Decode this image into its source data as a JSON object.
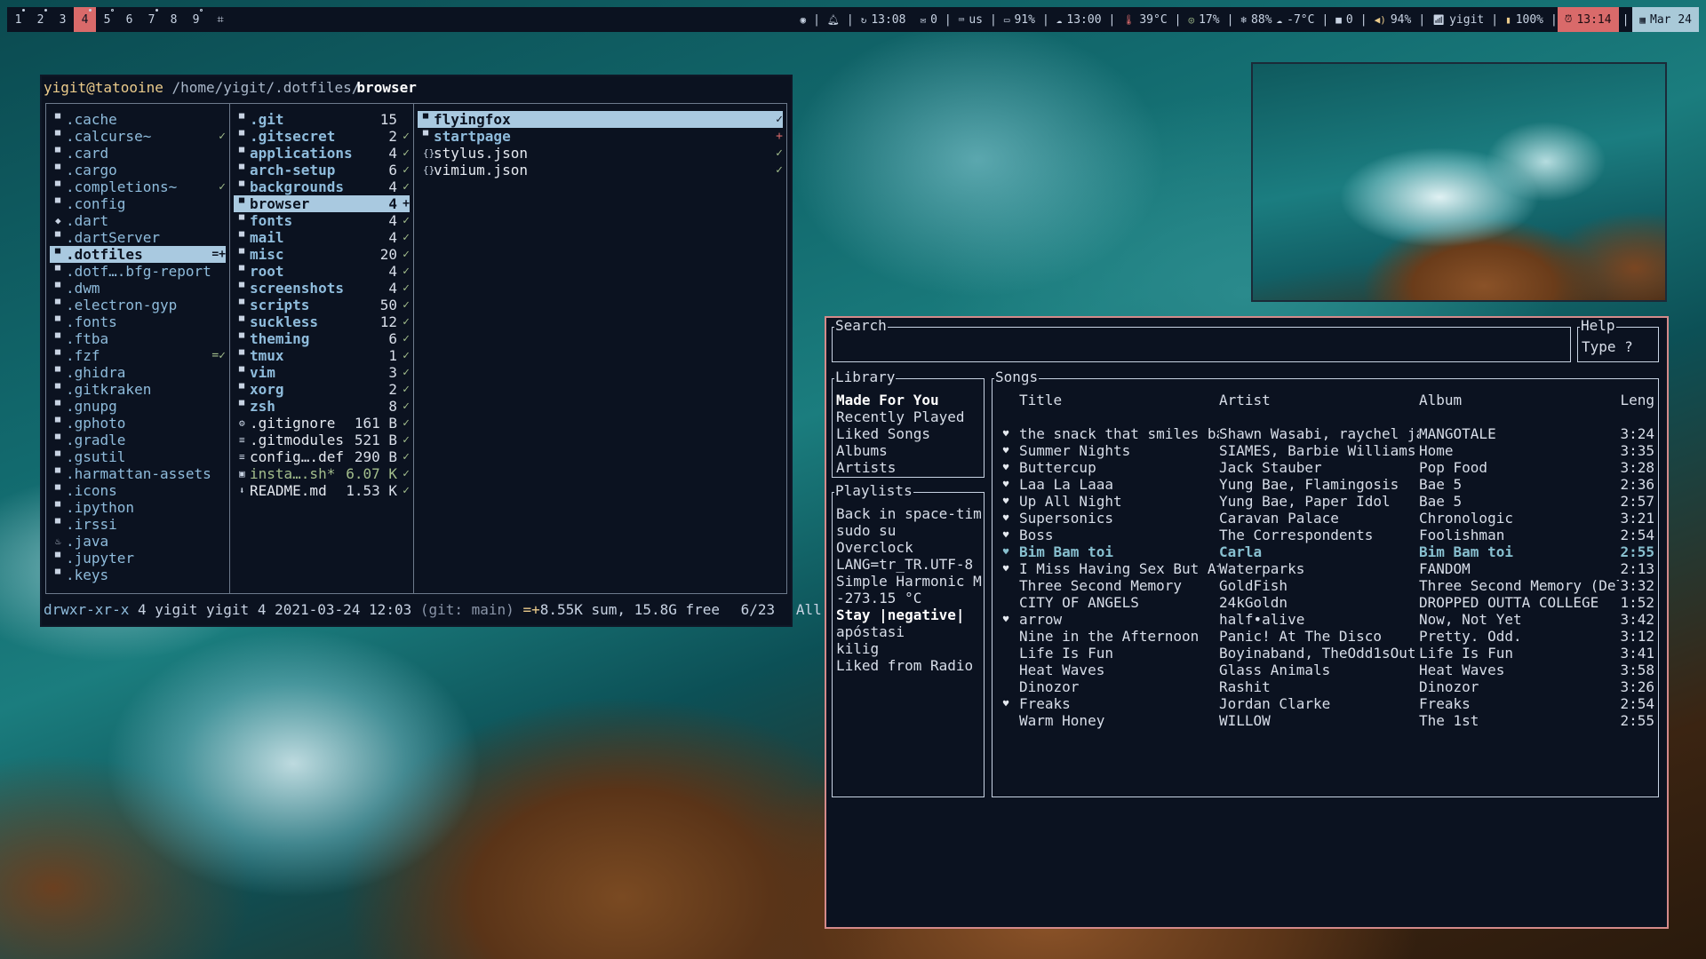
{
  "topbar": {
    "workspaces": [
      {
        "label": "1",
        "dot": "filled"
      },
      {
        "label": "2",
        "dot": "filled"
      },
      {
        "label": "3",
        "dot": ""
      },
      {
        "label": "4",
        "dot": "filled",
        "active": true
      },
      {
        "label": "5",
        "dot": "open"
      },
      {
        "label": "6",
        "dot": ""
      },
      {
        "label": "7",
        "dot": "filled"
      },
      {
        "label": "8",
        "dot": ""
      },
      {
        "label": "9",
        "dot": "open"
      }
    ],
    "layout_icon": "tile-layout-icon",
    "update_time": "13:08",
    "mail_count": "0",
    "keyboard_layout": "us",
    "battery_percent": "91%",
    "clock_hour": "13:00",
    "cpu_temp": "39°C",
    "cpu_usage": "17%",
    "humidity": "88%",
    "weather_temp": "-7°C",
    "packages": "0",
    "volume": "94%",
    "wifi_name": "yigit",
    "brightness": "100%",
    "alarm_time": "13:14",
    "date": "Mar 24",
    "colors": {
      "accent": "#d96a6a",
      "date_bg": "#a9c9d8",
      "bar_bg": "#0b1220"
    }
  },
  "file_manager": {
    "title_user": "yigit@tatooine",
    "title_path": "/home/yigit/.dotfiles/",
    "title_current": "browser",
    "col1": [
      {
        "name": ".cache",
        "status": ""
      },
      {
        "name": ".calcurse~",
        "status": "✓"
      },
      {
        "name": ".card",
        "status": ""
      },
      {
        "name": ".cargo",
        "status": ""
      },
      {
        "name": ".completions~",
        "status": "✓"
      },
      {
        "name": ".config",
        "status": ""
      },
      {
        "name": ".dart",
        "status": "",
        "icon": "◆"
      },
      {
        "name": ".dartServer",
        "status": ""
      },
      {
        "name": ".dotfiles",
        "status": "=+",
        "selected": true
      },
      {
        "name": ".dotf….bfg-report",
        "status": ""
      },
      {
        "name": ".dwm",
        "status": ""
      },
      {
        "name": ".electron-gyp",
        "status": ""
      },
      {
        "name": ".fonts",
        "status": ""
      },
      {
        "name": ".ftba",
        "status": ""
      },
      {
        "name": ".fzf",
        "status": "=✓"
      },
      {
        "name": ".ghidra",
        "status": ""
      },
      {
        "name": ".gitkraken",
        "status": ""
      },
      {
        "name": ".gnupg",
        "status": ""
      },
      {
        "name": ".gphoto",
        "status": ""
      },
      {
        "name": ".gradle",
        "status": ""
      },
      {
        "name": ".gsutil",
        "status": ""
      },
      {
        "name": ".harmattan-assets",
        "status": ""
      },
      {
        "name": ".icons",
        "status": ""
      },
      {
        "name": ".ipython",
        "status": ""
      },
      {
        "name": ".irssi",
        "status": ""
      },
      {
        "name": ".java",
        "status": "",
        "icon": "♨"
      },
      {
        "name": ".jupyter",
        "status": ""
      },
      {
        "name": ".keys",
        "status": ""
      }
    ],
    "col2": [
      {
        "name": ".git",
        "count": "15",
        "status": "",
        "type": "dir"
      },
      {
        "name": ".gitsecret",
        "count": "2",
        "status": "✓",
        "type": "dir"
      },
      {
        "name": "applications",
        "count": "4",
        "status": "✓",
        "type": "dir"
      },
      {
        "name": "arch-setup",
        "count": "6",
        "status": "✓",
        "type": "dir"
      },
      {
        "name": "backgrounds",
        "count": "4",
        "status": "✓",
        "type": "dir"
      },
      {
        "name": "browser",
        "count": "4",
        "status": "+",
        "type": "dir",
        "selected": true
      },
      {
        "name": "fonts",
        "count": "4",
        "status": "✓",
        "type": "dir"
      },
      {
        "name": "mail",
        "count": "4",
        "status": "✓",
        "type": "dir"
      },
      {
        "name": "misc",
        "count": "20",
        "status": "✓",
        "type": "dir"
      },
      {
        "name": "root",
        "count": "4",
        "status": "✓",
        "type": "dir"
      },
      {
        "name": "screenshots",
        "count": "4",
        "status": "✓",
        "type": "dir"
      },
      {
        "name": "scripts",
        "count": "50",
        "status": "✓",
        "type": "dir"
      },
      {
        "name": "suckless",
        "count": "12",
        "status": "✓",
        "type": "dir"
      },
      {
        "name": "theming",
        "count": "6",
        "status": "✓",
        "type": "dir"
      },
      {
        "name": "tmux",
        "count": "1",
        "status": "✓",
        "type": "dir"
      },
      {
        "name": "vim",
        "count": "3",
        "status": "✓",
        "type": "dir"
      },
      {
        "name": "xorg",
        "count": "2",
        "status": "✓",
        "type": "dir"
      },
      {
        "name": "zsh",
        "count": "8",
        "status": "✓",
        "type": "dir"
      },
      {
        "name": ".gitignore",
        "count": "161 B",
        "status": "✓",
        "type": "file",
        "icon": "⚙"
      },
      {
        "name": ".gitmodules",
        "count": "521 B",
        "status": "✓",
        "type": "file",
        "icon": "≡"
      },
      {
        "name": "config….def",
        "count": "290 B",
        "status": "✓",
        "type": "file",
        "icon": "≡"
      },
      {
        "name": "insta….sh*",
        "count": "6.07 K",
        "status": "✓",
        "type": "exec",
        "icon": "▣"
      },
      {
        "name": "README.md",
        "count": "1.53 K",
        "status": "✓",
        "type": "file",
        "icon": "⬇"
      }
    ],
    "col3": [
      {
        "name": "flyingfox",
        "status": "✓",
        "type": "dir",
        "selected": true
      },
      {
        "name": "startpage",
        "status": "+",
        "type": "dir"
      },
      {
        "name": "stylus.json",
        "status": "✓",
        "type": "file",
        "icon": "{}"
      },
      {
        "name": "vimium.json",
        "status": "✓",
        "type": "file",
        "icon": "{}"
      }
    ],
    "status": {
      "perms": "drwxr-xr-x",
      "info": " 4 yigit yigit 4 2021-03-24 12:03 ",
      "git": "(git: main)",
      "git_mark": " =+",
      "disk": "8.55K sum, 15.8G free",
      "position": "6/23",
      "scroll": "All"
    }
  },
  "music_player": {
    "search_label": "Search",
    "search_value": "",
    "help_label": "Help",
    "help_value": "Type ?",
    "library_label": "Library",
    "library": [
      {
        "label": "Made For You",
        "bold": true
      },
      {
        "label": "Recently Played"
      },
      {
        "label": "Liked Songs"
      },
      {
        "label": "Albums"
      },
      {
        "label": "Artists"
      }
    ],
    "playlists_label": "Playlists",
    "playlists": [
      {
        "label": "Back in space-time"
      },
      {
        "label": "sudo su"
      },
      {
        "label": "Overclock"
      },
      {
        "label": "LANG=tr_TR.UTF-8"
      },
      {
        "label": "Simple Harmonic Mo"
      },
      {
        "label": "-273.15 °C"
      },
      {
        "label": "Stay |negative|",
        "bold": true
      },
      {
        "label": "apóstasi"
      },
      {
        "label": "kilig"
      },
      {
        "label": "Liked from Radio"
      }
    ],
    "songs_label": "Songs",
    "columns": {
      "title": "Title",
      "artist": "Artist",
      "album": "Album",
      "length": "Leng"
    },
    "songs": [
      {
        "liked": true,
        "title": "the snack that smiles ba",
        "artist": "Shawn Wasabi, raychel ja",
        "album": "MANGOTALE",
        "length": "3:24"
      },
      {
        "liked": true,
        "title": "Summer Nights",
        "artist": "SIAMES, Barbie Williams",
        "album": "Home",
        "length": "3:35"
      },
      {
        "liked": true,
        "title": "Buttercup",
        "artist": "Jack Stauber",
        "album": "Pop Food",
        "length": "3:28"
      },
      {
        "liked": true,
        "title": "Laa La Laaa",
        "artist": "Yung Bae, Flamingosis",
        "album": "Bae 5",
        "length": "2:36"
      },
      {
        "liked": true,
        "title": "Up All Night",
        "artist": "Yung Bae, Paper Idol",
        "album": "Bae 5",
        "length": "2:57"
      },
      {
        "liked": true,
        "title": "Supersonics",
        "artist": "Caravan Palace",
        "album": "Chronologic",
        "length": "3:21"
      },
      {
        "liked": true,
        "title": "Boss",
        "artist": "The Correspondents",
        "album": "Foolishman",
        "length": "2:54"
      },
      {
        "liked": true,
        "title": "Bim Bam toi",
        "artist": "Carla",
        "album": "Bim Bam toi",
        "length": "2:55",
        "playing": true
      },
      {
        "liked": true,
        "title": "I Miss Having Sex But At",
        "artist": "Waterparks",
        "album": "FANDOM",
        "length": "2:13"
      },
      {
        "liked": false,
        "title": "Three Second Memory",
        "artist": "GoldFish",
        "album": "Three Second Memory (Del",
        "length": "3:32"
      },
      {
        "liked": false,
        "title": "CITY OF ANGELS",
        "artist": "24kGoldn",
        "album": "DROPPED OUTTA COLLEGE",
        "length": "1:52"
      },
      {
        "liked": true,
        "title": "arrow",
        "artist": "half•alive",
        "album": "Now, Not Yet",
        "length": "3:42"
      },
      {
        "liked": false,
        "title": "Nine in the Afternoon",
        "artist": "Panic! At The Disco",
        "album": "Pretty. Odd.",
        "length": "3:12"
      },
      {
        "liked": false,
        "title": "Life Is Fun",
        "artist": "Boyinaband, TheOdd1sOut",
        "album": "Life Is Fun",
        "length": "3:41"
      },
      {
        "liked": false,
        "title": "Heat Waves",
        "artist": "Glass Animals",
        "album": "Heat Waves",
        "length": "3:58"
      },
      {
        "liked": false,
        "title": "Dinozor",
        "artist": "Rashit",
        "album": "Dinozor",
        "length": "3:26"
      },
      {
        "liked": true,
        "title": "Freaks",
        "artist": "Jordan Clarke",
        "album": "Freaks",
        "length": "2:54"
      },
      {
        "liked": false,
        "title": "Warm Honey",
        "artist": "WILLOW",
        "album": "The 1st",
        "length": "2:55"
      }
    ],
    "colors": {
      "border": "#d48a8a",
      "playing": "#88c0d0"
    }
  }
}
